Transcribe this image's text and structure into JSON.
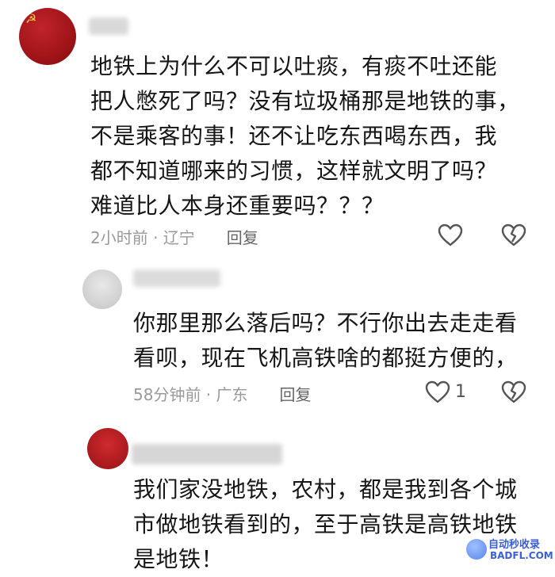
{
  "main_comment": {
    "text": "地铁上为什么不可以吐痰，有痰不吐还能\n把人憋死了吗？没有垃圾桶那是地铁的事，\n不是乘客的事！还不让吃东西喝东西，我\n都不知道哪来的习惯，这样就文明了吗？\n难道比人本身还重要吗？？？",
    "time_location": "2小时前 · 辽宁",
    "reply_label": "回复"
  },
  "reply1": {
    "text": "你那里那么落后吗？不行你出去走走看\n看呗，现在飞机高铁啥的都挺方便的，",
    "time_location": "58分钟前 · 广东",
    "reply_label": "回复",
    "like_count": "1"
  },
  "reply2": {
    "text": "我们家没地铁，农村，都是我到各个城\n市做地铁看到的，至于高铁是高铁地铁\n是地铁！"
  },
  "watermark": {
    "line1": "自动秒收录",
    "line2": "BADFL.COM"
  },
  "icons": {
    "like": "heart-outline-icon",
    "dislike": "broken-heart-icon"
  },
  "colors": {
    "text": "#161616",
    "meta": "#9a9a9a",
    "avatar_red": "#a01418"
  }
}
